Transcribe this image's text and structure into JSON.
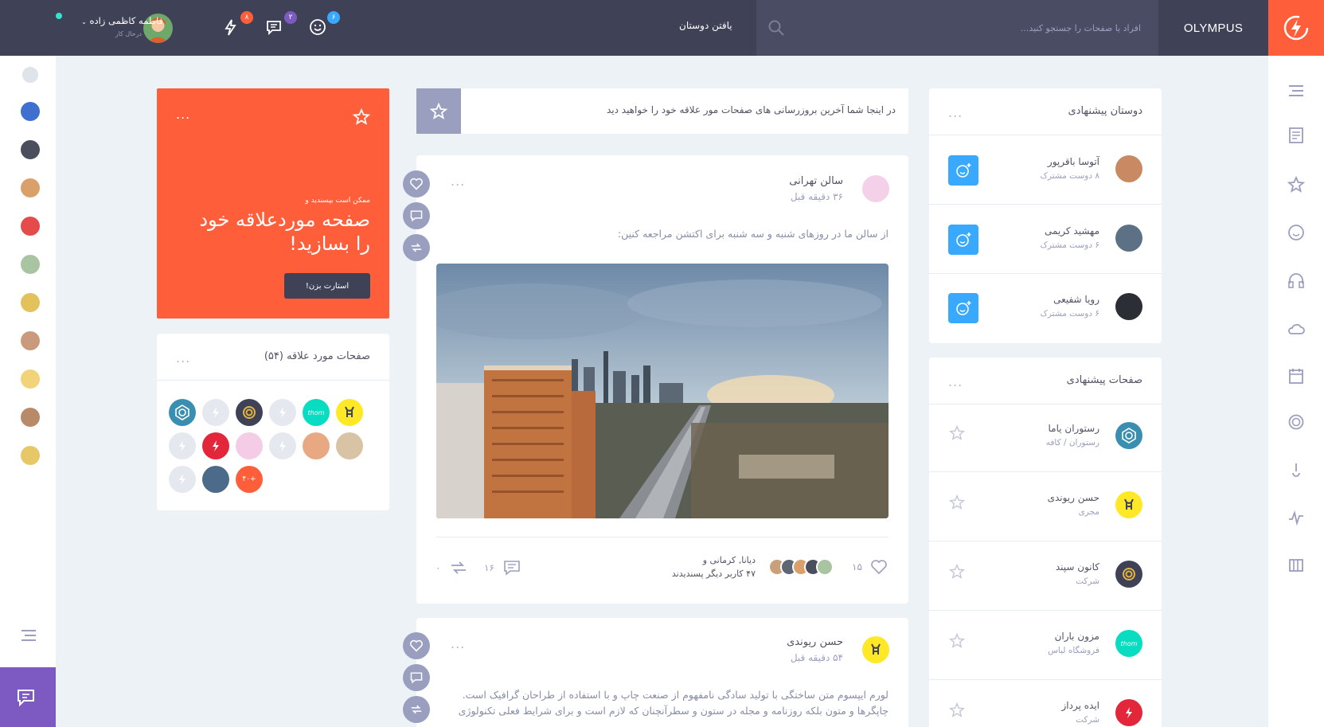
{
  "header": {
    "brand": "OLYMPUS",
    "search_placeholder": "افراد یا صفحات را جستجو کنید...",
    "find_friends": "یافتن دوستان",
    "badges": {
      "friends": "۶",
      "messages": "۲",
      "notifications": "۸"
    },
    "user": {
      "name": "فاطمه کاظمی زاده",
      "status": "درحال کار"
    },
    "colors": {
      "header_bg": "#3f4257",
      "accent": "#ff5e3a",
      "blue": "#38a9ff",
      "purple": "#7c5ac2"
    }
  },
  "promo": {
    "small": "ممکن است بپسندید و",
    "headline_1": "صفحه موردعلاقه خود",
    "headline_2": "را بسازید!",
    "button": "استارت بزن!",
    "menu": "..."
  },
  "fav_pages": {
    "title": "صفحات مورد علاقه (۵۴)",
    "menu": "...",
    "more_label": "۴۰+",
    "icons": [
      "pen-logo",
      "deer-logo",
      "olympus-logo",
      "wifi-logo",
      "olympus-logo",
      "geo-logo",
      "avatar-girl",
      "avatar-bunny",
      "olympus-logo",
      "avatar-boy",
      "flash-logo",
      "olympus-logo",
      "avatar-beard",
      "more"
    ]
  },
  "feed_banner": {
    "text": "در اینجا شما آخرین بروزرسانی های صفحات مور علاقه خود را خواهید دید"
  },
  "post1": {
    "author": "سالن تهرانی",
    "time": "۳۶ دقیقه قبل",
    "text": "از سالن ما در روزهای شنبه و سه شنبه برای اکتشن مراجعه کنین:",
    "likes": "۱۵",
    "liked_by_1": "دیانا, کرمانی و",
    "liked_by_2": "۴۷ کاربر دیگر پسندیدند",
    "comments": "۱۶",
    "shares": "۰",
    "menu": "..."
  },
  "post2": {
    "author": "حسن ریوندی",
    "time": "۵۴ دقیقه قبل",
    "line1": "لورم ایپسوم متن ساختگی با تولید سادگی نامفهوم از صنعت چاپ و با استفاده از طراحان گرافیک است.",
    "line2": "چاپگرها و متون بلکه روزنامه و مجله در ستون و سطرآنچنان که لازم است و برای شرایط فعلی تکنولوژی",
    "menu": "..."
  },
  "friends": {
    "title": "دوستان پیشنهادی",
    "menu": "...",
    "items": [
      {
        "name": "آتوسا باقرپور",
        "mutual": "۸ دوست مشترک"
      },
      {
        "name": "مهشید کریمی",
        "mutual": "۶ دوست مشترک"
      },
      {
        "name": "رویا شفیعی",
        "mutual": "۶ دوست مشترک"
      }
    ]
  },
  "pages": {
    "title": "صفحات پیشنهادی",
    "menu": "...",
    "items": [
      {
        "name": "رستوران یاما",
        "type": "رستوران / کافه"
      },
      {
        "name": "حسن ریوندی",
        "type": "مجری"
      },
      {
        "name": "کانون سپند",
        "type": "شرکت"
      },
      {
        "name": "مزون باران",
        "type": "فروشگاه لباس"
      },
      {
        "name": "ایده پرداز",
        "type": "شرکت"
      }
    ]
  },
  "misc": {
    "thom_label": "thom"
  }
}
